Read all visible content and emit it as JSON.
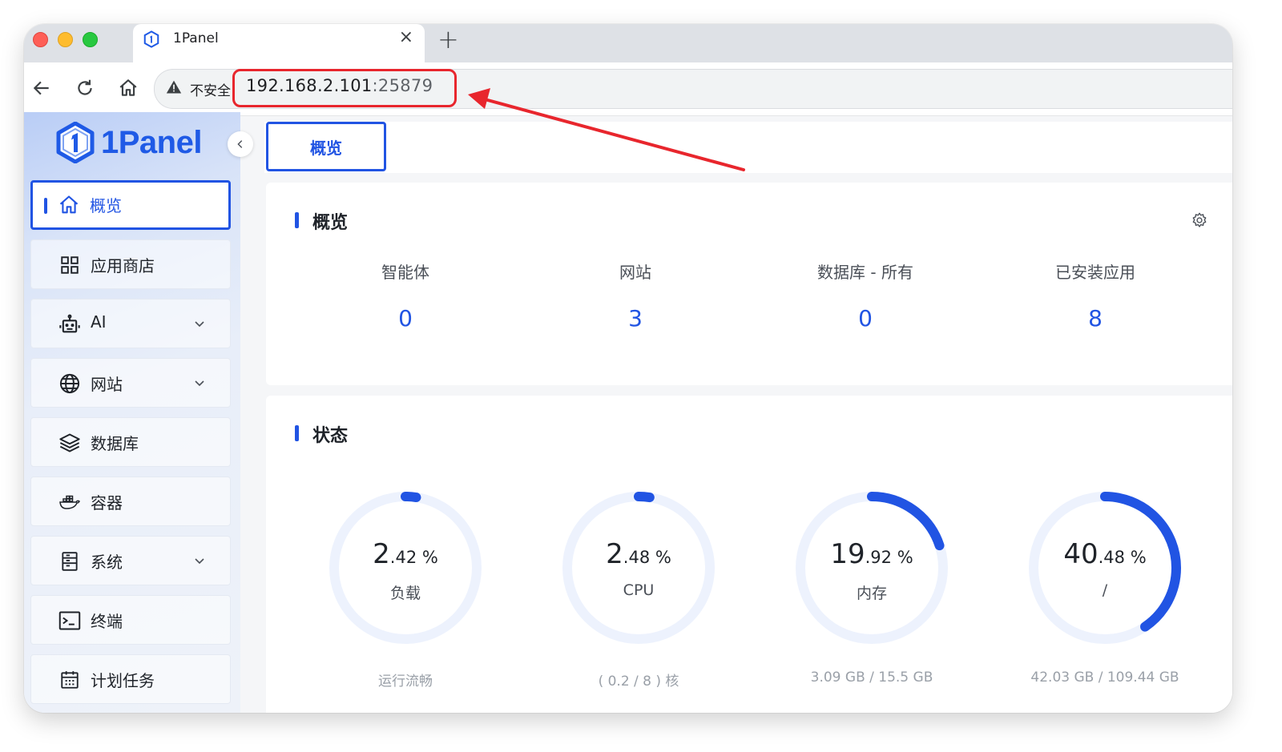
{
  "browser": {
    "tab_title": "1Panel",
    "close_glyph": "×",
    "newtab_glyph": "+",
    "security_label": "不安全",
    "url_host": "192.168.2.101",
    "url_port": ":25879"
  },
  "sidebar": {
    "logo_text": "1Panel",
    "items": [
      {
        "label": "概览",
        "icon": "home-icon",
        "active": true
      },
      {
        "label": "应用商店",
        "icon": "grid-icon"
      },
      {
        "label": "AI",
        "icon": "robot-icon",
        "expandable": true
      },
      {
        "label": "网站",
        "icon": "globe-icon",
        "expandable": true
      },
      {
        "label": "数据库",
        "icon": "layers-icon"
      },
      {
        "label": "容器",
        "icon": "docker-icon"
      },
      {
        "label": "系统",
        "icon": "server-icon",
        "expandable": true
      },
      {
        "label": "终端",
        "icon": "terminal-icon"
      },
      {
        "label": "计划任务",
        "icon": "calendar-icon"
      }
    ]
  },
  "main": {
    "active_tab": "概览",
    "overview": {
      "title": "概览",
      "stats": [
        {
          "label": "智能体",
          "value": "0"
        },
        {
          "label": "网站",
          "value": "3"
        },
        {
          "label": "数据库 - 所有",
          "value": "0"
        },
        {
          "label": "已安装应用",
          "value": "8"
        }
      ]
    },
    "status": {
      "title": "状态",
      "gauges": [
        {
          "int": "2",
          "dec": ".42",
          "unit": " %",
          "name": "负载",
          "sub": "运行流畅",
          "fraction": 0.0242
        },
        {
          "int": "2",
          "dec": ".48",
          "unit": " %",
          "name": "CPU",
          "sub": "( 0.2 / 8 ) 核",
          "fraction": 0.0248
        },
        {
          "int": "19",
          "dec": ".92",
          "unit": " %",
          "name": "内存",
          "sub": "3.09 GB / 15.5 GB",
          "fraction": 0.1992
        },
        {
          "int": "40",
          "dec": ".48",
          "unit": " %",
          "name": "/",
          "sub": "42.03 GB / 109.44 GB",
          "fraction": 0.4048
        }
      ]
    }
  },
  "colors": {
    "accent": "#2154e3",
    "gauge_track": "#edf2fd",
    "annotation": "#e8262d"
  }
}
